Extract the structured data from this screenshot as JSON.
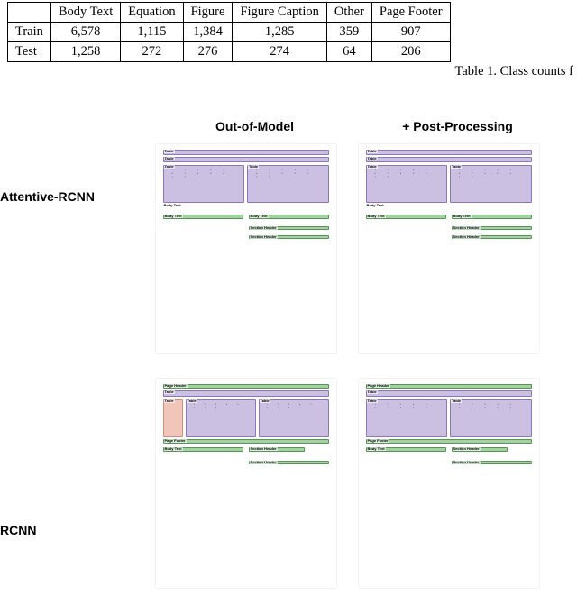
{
  "table": {
    "headers": [
      "",
      "Body Text",
      "Equation",
      "Figure",
      "Figure Caption",
      "Other",
      "Page Footer"
    ],
    "rows": [
      {
        "label": "Train",
        "values": [
          "6,578",
          "1,115",
          "1,384",
          "1,285",
          "359",
          "907"
        ]
      },
      {
        "label": "Test",
        "values": [
          "1,258",
          "272",
          "276",
          "274",
          "64",
          "206"
        ]
      }
    ],
    "caption": "Table 1. Class counts f"
  },
  "grid": {
    "col_headers": [
      "Out-of-Model",
      "+ Post-Processing"
    ],
    "row_headers": [
      "Attentive-RCNN",
      "RCNN"
    ]
  },
  "region_labels": {
    "table": "Table",
    "body": "Body Text",
    "header": "Page Header",
    "footer": "Page Footer",
    "section": "Section Header"
  },
  "chart_data": [
    {
      "type": "table",
      "title": "Class counts",
      "categories": [
        "Body Text",
        "Equation",
        "Figure",
        "Figure Caption",
        "Other",
        "Page Footer"
      ],
      "series": [
        {
          "name": "Train",
          "values": [
            6578,
            1115,
            1384,
            1285,
            359,
            907
          ]
        },
        {
          "name": "Test",
          "values": [
            1258,
            272,
            276,
            274,
            64,
            206
          ]
        }
      ]
    }
  ]
}
